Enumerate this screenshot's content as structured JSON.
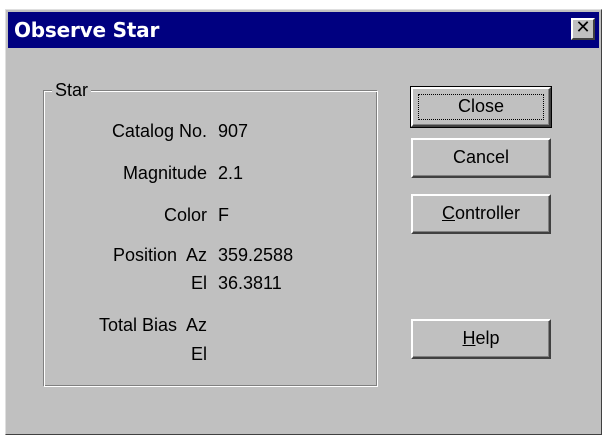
{
  "window": {
    "title": "Observe Star",
    "close_glyph": "✕"
  },
  "star_group": {
    "legend": "Star",
    "catalog_label": "Catalog No.",
    "catalog_value": "907",
    "magnitude_label": "Magnitude",
    "magnitude_value": "2.1",
    "color_label": "Color",
    "color_value": "F",
    "position_az_label": "Position  Az",
    "position_az_value": "359.2588",
    "position_el_label": "El",
    "position_el_value": "36.3811",
    "total_bias_az_label": "Total Bias  Az",
    "total_bias_el_label": "El"
  },
  "buttons": {
    "close_label": "Close",
    "cancel_label": "Cancel",
    "controller_rest": "ontroller",
    "controller_mnemonic": "C",
    "help_mnemonic": "H",
    "help_rest": "elp"
  },
  "colors": {
    "titlebar": "#000080",
    "face": "#c0c0c0"
  }
}
